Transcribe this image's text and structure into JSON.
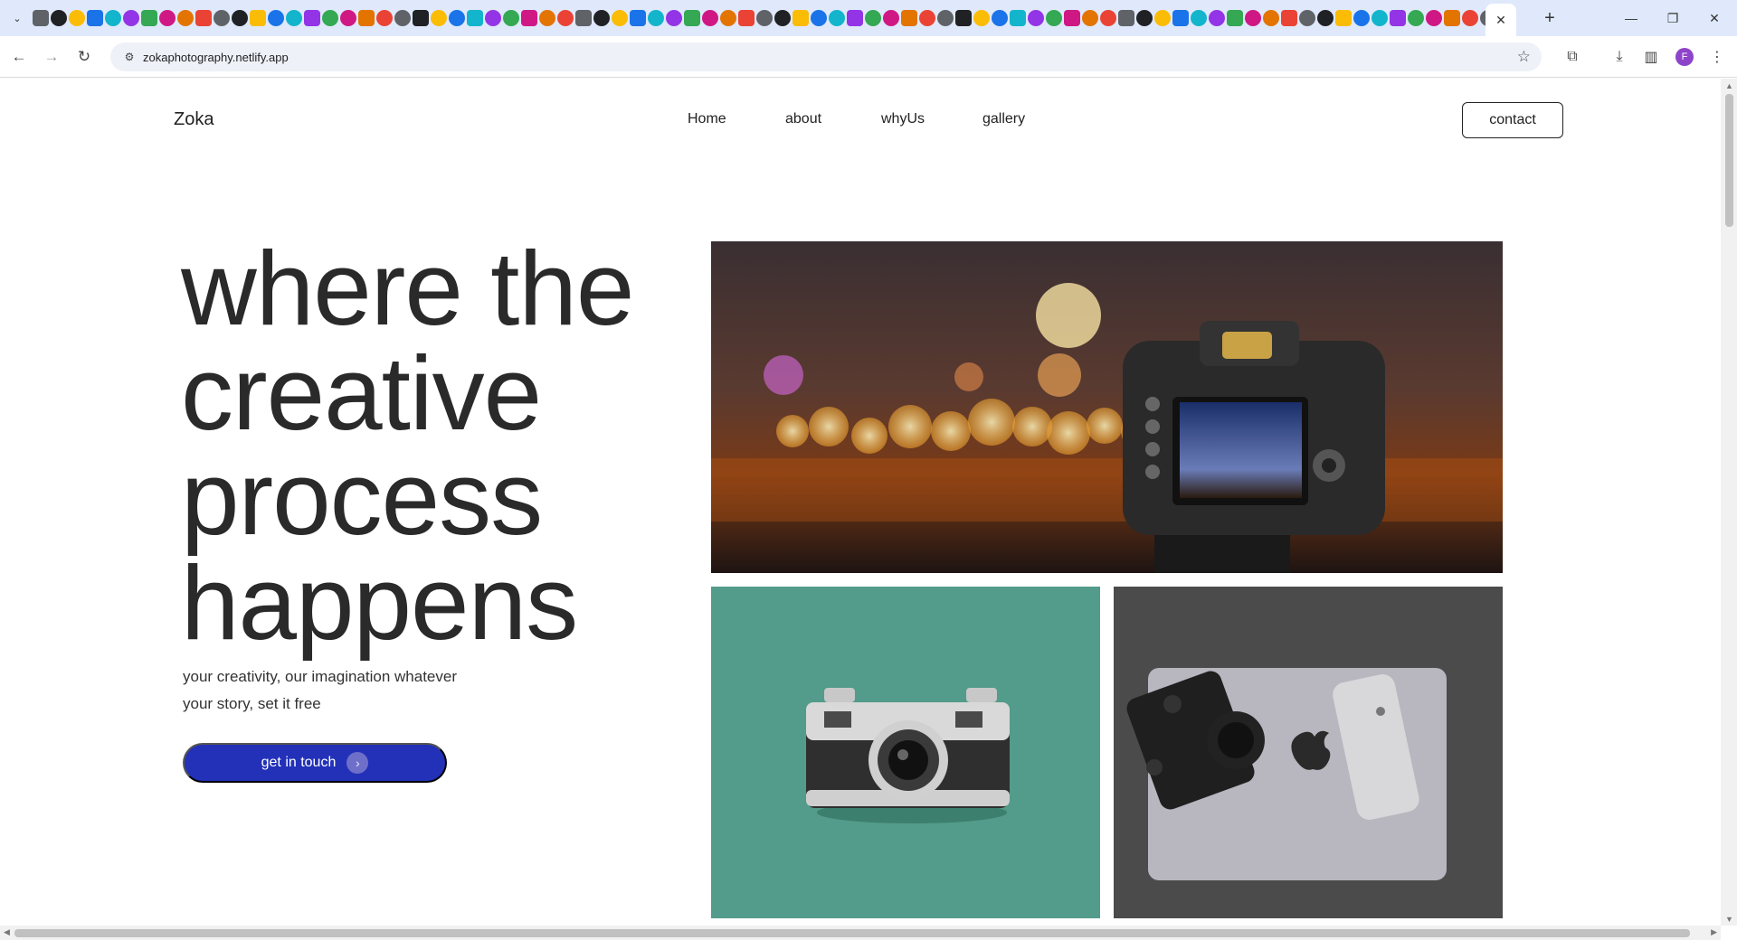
{
  "browser": {
    "tab_close": "✕",
    "new_tab": "+",
    "url": "zokaphotography.netlify.app",
    "profile_initial": "F"
  },
  "nav": {
    "brand": "Zoka",
    "links": [
      "Home",
      "about",
      "whyUs",
      "gallery"
    ],
    "contact": "contact"
  },
  "hero": {
    "title_lines": [
      "where the",
      "creative",
      "process",
      "happens"
    ],
    "subtitle_lines": [
      "your creativity, our imagination whatever",
      "your story, set it free"
    ],
    "cta_label": "get in touch",
    "cta_icon": "›"
  },
  "gallery": {
    "images": [
      "camera-bokeh-photo",
      "vintage-camera-photo",
      "laptop-camera-phone-photo"
    ]
  },
  "colors": {
    "cta_blue": "#2231b8",
    "teal_bg": "#539b8a",
    "text_dark": "#2a2a2a",
    "tabstrip": "#dfe9fb"
  }
}
